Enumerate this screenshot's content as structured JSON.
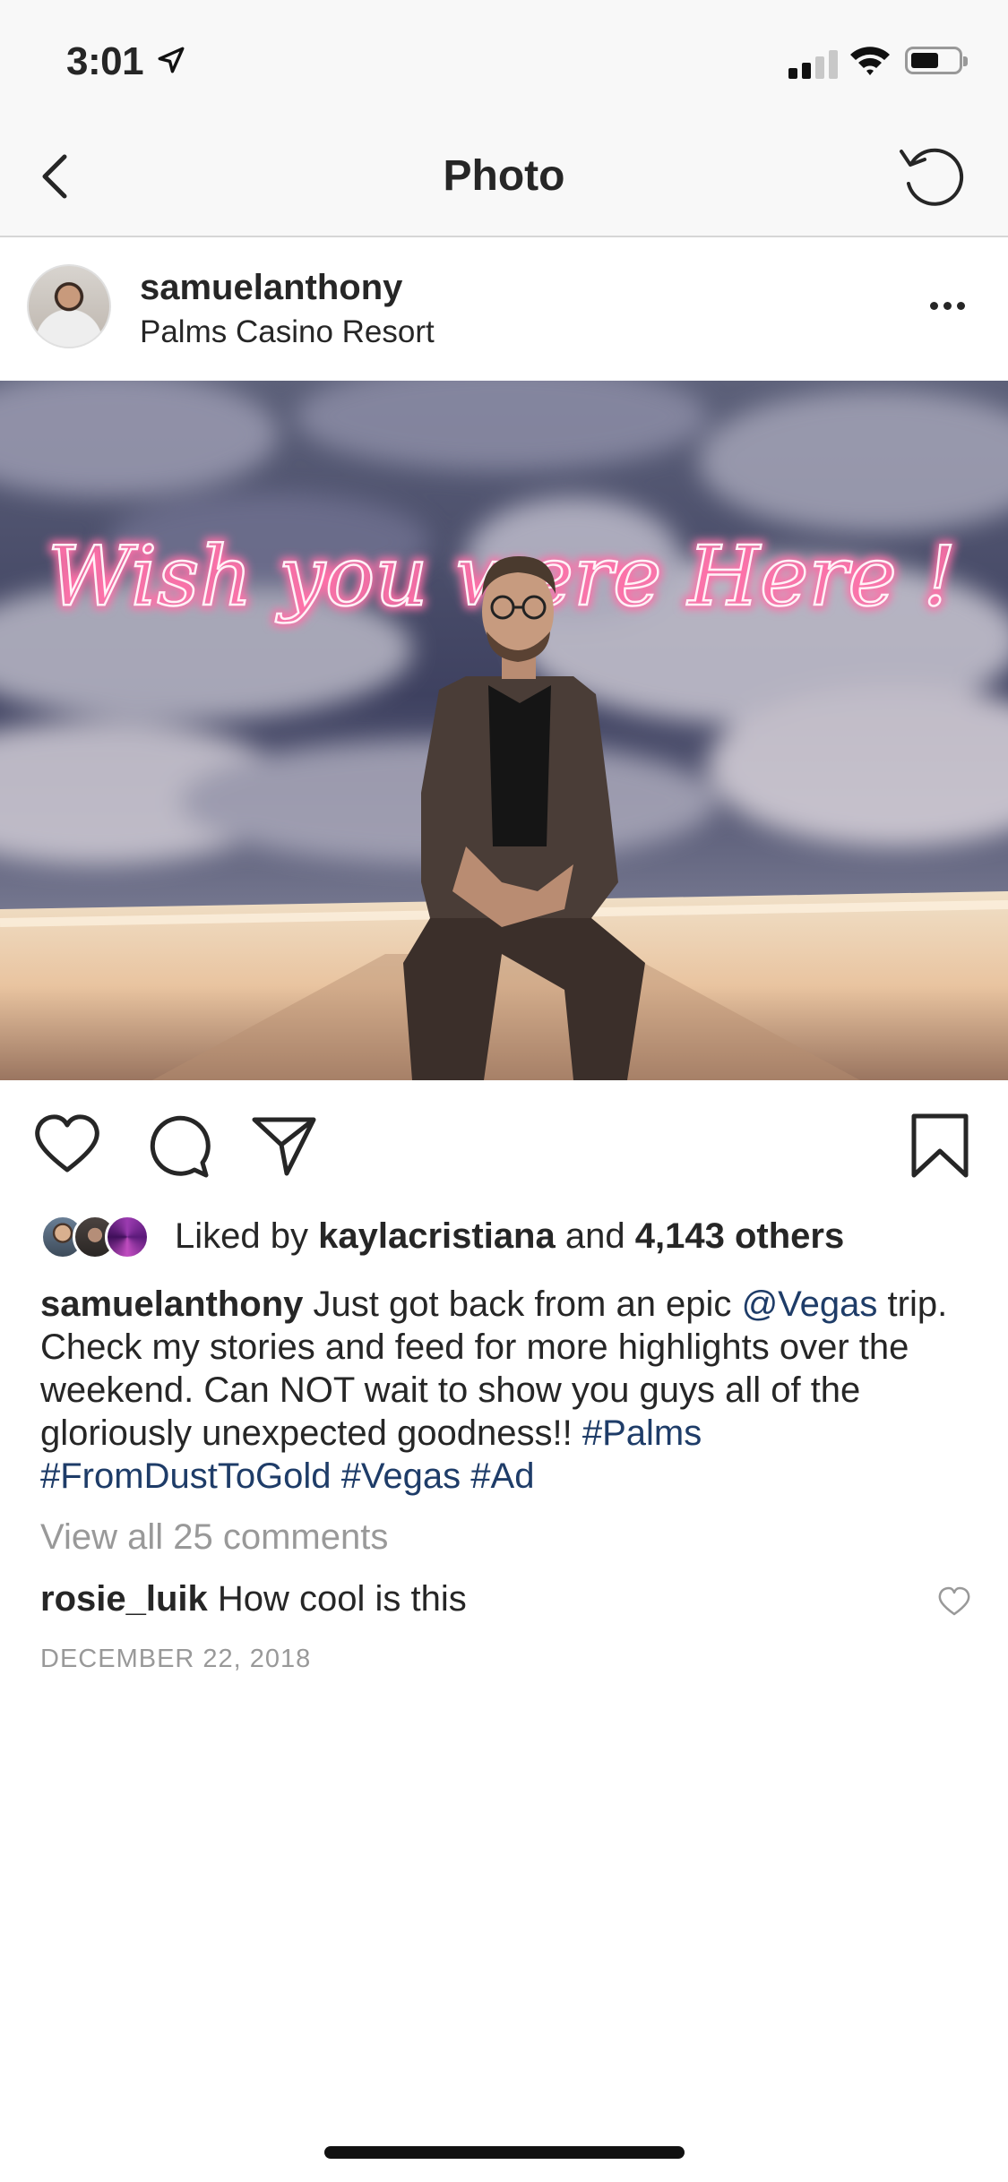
{
  "status_bar": {
    "time": "3:01"
  },
  "nav": {
    "title": "Photo"
  },
  "post": {
    "username": "samuelanthony",
    "location": "Palms Casino Resort",
    "likes": {
      "prefix": "Liked by",
      "user": "kaylacristiana",
      "middle": "and",
      "count": "4,143 others"
    },
    "caption": {
      "username": "samuelanthony",
      "text_1": "Just got back from an epic",
      "mention": "@Vegas",
      "text_2": "trip. Check my stories and feed for more highlights over the weekend. Can NOT wait to show you guys all of the gloriously unexpected goodness!!",
      "hashtags": [
        "#Palms",
        "#FromDustToGold",
        "#Vegas",
        "#Ad"
      ]
    },
    "view_all_comments": "View all 25 comments",
    "comment": {
      "username": "rosie_luik",
      "text": "How cool is this"
    },
    "date": "DECEMBER 22, 2018",
    "photo": {
      "neon_text": "Wish you were Here !"
    }
  },
  "colors": {
    "link": "#1e3c68",
    "muted": "#999999",
    "text": "#262626",
    "bar": "#f8f8f8"
  },
  "icons": [
    "location-arrow-icon",
    "signal-icon",
    "wifi-icon",
    "battery-icon",
    "back-chevron-icon",
    "refresh-icon",
    "more-icon",
    "heart-icon",
    "comment-icon",
    "share-icon",
    "bookmark-icon",
    "small-heart-icon"
  ]
}
